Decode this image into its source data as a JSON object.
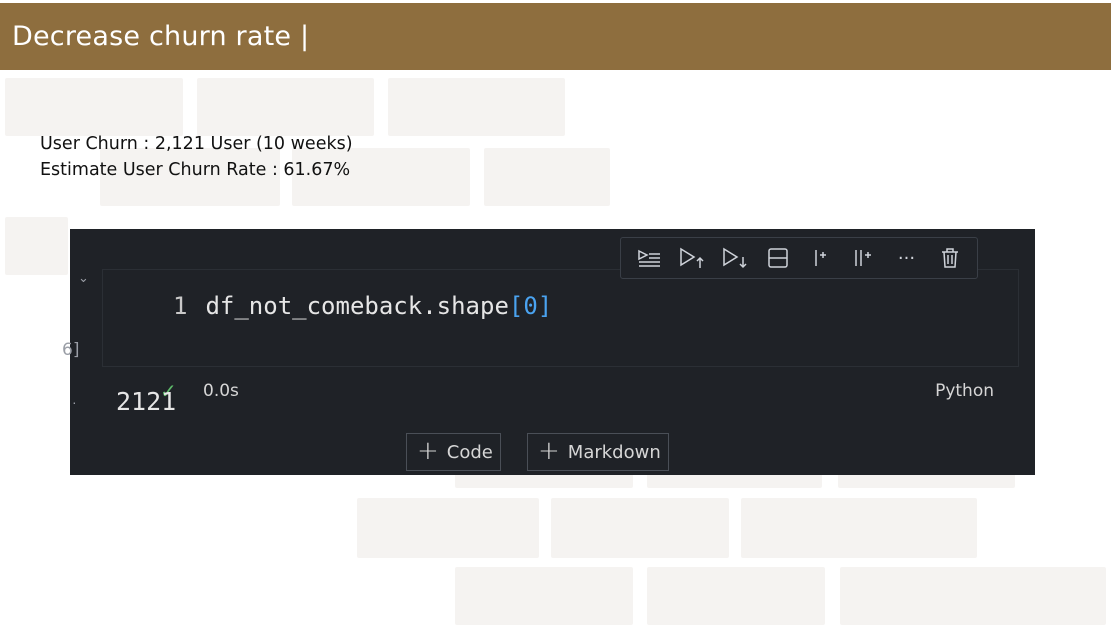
{
  "header": {
    "title": "Decrease churn rate |"
  },
  "stats": {
    "line1": "User Churn : 2,121 User (10 weeks)",
    "line2": "Estimate User Churn Rate : 61.67%"
  },
  "notebook": {
    "cell": {
      "line_number": "1",
      "code_prefix": "df_not_comeback.shape",
      "code_open_bracket": "[",
      "code_index": "0",
      "code_close_bracket": "]",
      "execution_count_fragment": "6]",
      "status_time": "0.0s",
      "language": "Python"
    },
    "output": {
      "marker": "·",
      "value": "2121"
    },
    "toolbar": {
      "icons": [
        "run-by-line-icon",
        "execute-above-icon",
        "execute-below-icon",
        "split-cell-icon",
        "add-cell-above-icon",
        "add-cell-below-icon",
        "more-icon",
        "delete-icon"
      ],
      "more_glyph": "···"
    },
    "add_buttons": {
      "code_label": "Code",
      "markdown_label": "Markdown",
      "plus": "+"
    }
  }
}
